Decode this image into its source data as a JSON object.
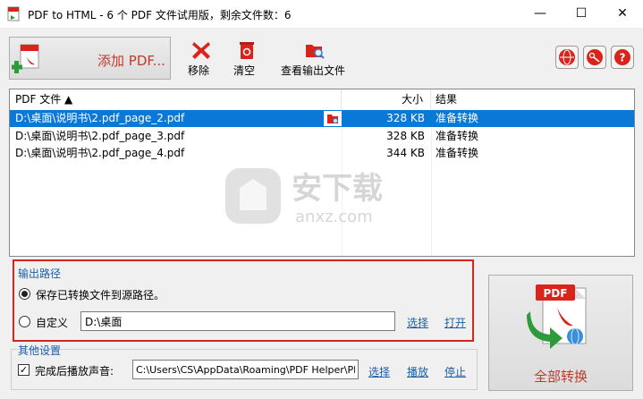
{
  "window": {
    "title": "PDF to HTML - 6 个 PDF 文件试用版，剩余文件数：6",
    "minimize": "—",
    "maximize": "☐",
    "close": "✕"
  },
  "toolbar": {
    "add_label": "添加 PDF...",
    "remove_label": "移除",
    "clear_label": "清空",
    "view_output_label": "查看输出文件"
  },
  "file_list": {
    "columns": [
      "PDF 文件 ▲",
      "大小",
      "结果"
    ],
    "rows": [
      {
        "name": "D:\\桌面\\说明书\\2.pdf_page_2.pdf",
        "size": "328 KB",
        "result": "准备转换",
        "selected": true
      },
      {
        "name": "D:\\桌面\\说明书\\2.pdf_page_3.pdf",
        "size": "328 KB",
        "result": "准备转换",
        "selected": false
      },
      {
        "name": "D:\\桌面\\说明书\\2.pdf_page_4.pdf",
        "size": "344 KB",
        "result": "准备转换",
        "selected": false
      }
    ]
  },
  "watermark": {
    "text": "安下载",
    "url": "anxz.com"
  },
  "output": {
    "title": "输出路径",
    "option_source": "保存已转换文件到源路径。",
    "option_custom": "自定义",
    "custom_path": "D:\\桌面",
    "select_link": "选择",
    "open_link": "打开"
  },
  "other": {
    "title": "其他设置",
    "play_sound_label": "完成后播放声音:",
    "sound_path": "C:\\Users\\CS\\AppData\\Roaming\\PDF Helper\\PDF",
    "select_link": "选择",
    "play_link": "播放",
    "stop_link": "停止"
  },
  "convert": {
    "label": "全部转换",
    "icon_text": "PDF"
  },
  "colors": {
    "accent_red": "#c0392b",
    "link_blue": "#1c5fa8",
    "selection": "#0a78d7",
    "highlight_border": "#d9241b"
  }
}
